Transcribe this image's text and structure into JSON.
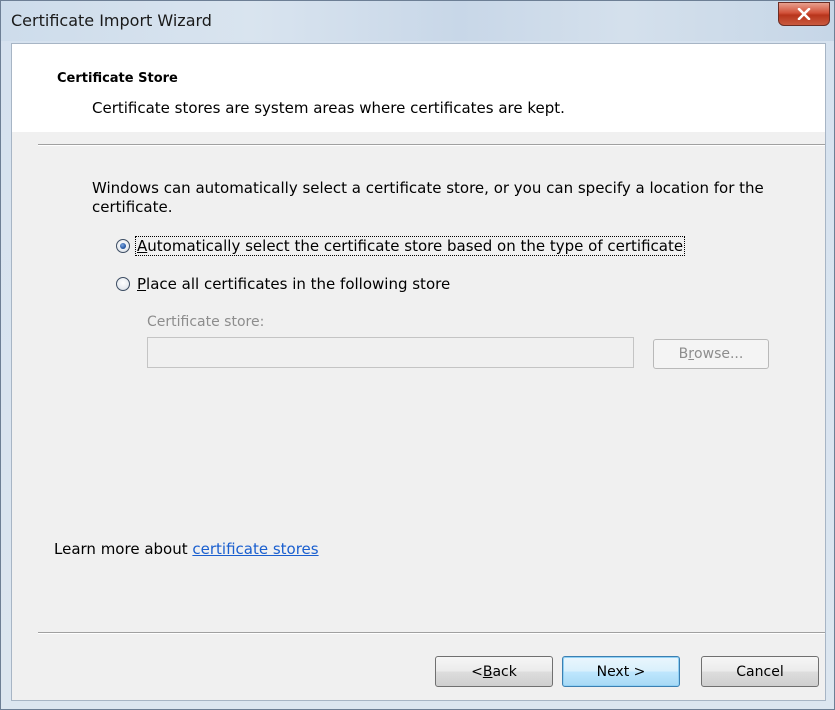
{
  "window": {
    "title": "Certificate Import Wizard",
    "close_icon": "close-x-icon"
  },
  "header": {
    "title": "Certificate Store",
    "subtitle": "Certificate stores are system areas where certificates are kept."
  },
  "body": {
    "intro": "Windows can automatically select a certificate store, or you can specify a location for the certificate.",
    "option_auto": {
      "accel": "A",
      "rest": "utomatically select the certificate store based on the type of certificate",
      "checked": true
    },
    "option_manual": {
      "accel": "P",
      "rest": "lace all certificates in the following store",
      "checked": false
    },
    "store_label": "Certificate store:",
    "store_value": "",
    "browse": {
      "pre": "B",
      "accel": "r",
      "post": "owse..."
    }
  },
  "learn_more": {
    "prefix": "Learn more about ",
    "link": "certificate stores"
  },
  "footer": {
    "back": {
      "pre": "< ",
      "accel": "B",
      "post": "ack"
    },
    "next": "Next >",
    "cancel": "Cancel"
  },
  "colors": {
    "link": "#1a5fcf",
    "close_button": "#c95a3f",
    "default_button_border": "#3c7fb1"
  }
}
